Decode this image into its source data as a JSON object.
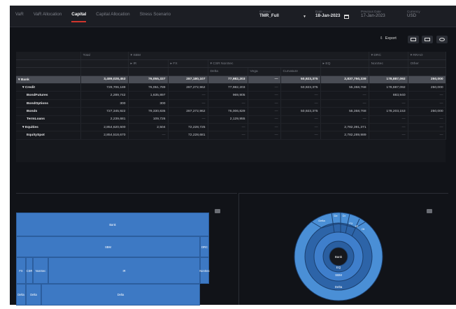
{
  "nav": {
    "tabs": [
      {
        "label": "VaR",
        "active": false
      },
      {
        "label": "VaR Allocation",
        "active": false
      },
      {
        "label": "Capital",
        "active": true
      },
      {
        "label": "Capital Allocation",
        "active": false
      },
      {
        "label": "Stress Scenario",
        "active": false
      }
    ],
    "context_label": "Context",
    "context_value": "TMR_Full",
    "date_label": "Date",
    "date_value": "18-Jan-2023",
    "prev_date_label": "Previous Date",
    "prev_date_value": "17-Jan-2023",
    "currency_label": "Currency",
    "currency_value": "USD"
  },
  "toolbar": {
    "export_label": "Export"
  },
  "grid": {
    "group_headers": {
      "total": "Total",
      "sbm": "SBM",
      "drc": "DRC",
      "rrao": "RRAO"
    },
    "sub_headers": {
      "ir": "IR",
      "fx": "FX",
      "csr": "CSR NonSec",
      "eq": "EQ",
      "nonsec": "NonSec",
      "other": "Other"
    },
    "leaf_headers": {
      "delta": "Delta",
      "vega": "Vega",
      "curvature": "Curvature"
    },
    "rows": [
      {
        "label": "Bank",
        "cells": [
          "3,489,028,453",
          "76,055,337",
          "287,180,107",
          "77,982,203",
          "—",
          "50,923,375",
          "2,837,750,339",
          "178,887,092",
          "250,000"
        ]
      },
      {
        "label": "Credit",
        "cells": [
          "729,706,189",
          "76,051,789",
          "287,272,962",
          "77,982,203",
          "—",
          "50,923,375",
          "55,358,768",
          "178,887,092",
          "250,000"
        ]
      },
      {
        "label": "BondFutures",
        "cells": [
          "2,289,742",
          "1,635,897",
          "—",
          "969,905",
          "—",
          "—",
          "—",
          "883,940",
          "—"
        ]
      },
      {
        "label": "BondOptions",
        "cells": [
          "300",
          "300",
          "—",
          "—",
          "—",
          "—",
          "—",
          "—",
          "—"
        ]
      },
      {
        "label": "Bonds",
        "cells": [
          "727,345,922",
          "79,330,835",
          "287,272,962",
          "76,006,829",
          "—",
          "50,923,375",
          "55,358,768",
          "178,203,153",
          "250,000"
        ]
      },
      {
        "label": "TermLoans",
        "cells": [
          "2,239,681",
          "109,726",
          "—",
          "2,129,955",
          "—",
          "—",
          "—",
          "—",
          "—"
        ]
      },
      {
        "label": "Equities",
        "cells": [
          "2,854,620,600",
          "2,504",
          "72,228,725",
          "—",
          "—",
          "—",
          "2,782,391,371",
          "—",
          "—"
        ]
      },
      {
        "label": "EquitySpot",
        "cells": [
          "2,854,518,670",
          "—",
          "72,228,681",
          "—",
          "—",
          "—",
          "2,782,289,989",
          "—",
          "—"
        ]
      }
    ]
  },
  "treemap": {
    "tiles": [
      "Bank",
      "SBM",
      "DRC",
      "FX",
      "CSR",
      "NonSec",
      "IR",
      "NonSec",
      "Delta",
      "Delta",
      "Delta"
    ]
  },
  "sunburst": {
    "center": "Bank",
    "ring1": "SBM",
    "ring2": "EQ",
    "ring3": "Delta",
    "outer_labels": [
      "Delta",
      "De",
      "Dr",
      "FX",
      "IR",
      "Ot"
    ]
  },
  "colors": {
    "accent": "#d0352d",
    "tile": "#3d79c4",
    "sun_light": "#4a8fd6",
    "sun_dark": "#2d64a8"
  }
}
